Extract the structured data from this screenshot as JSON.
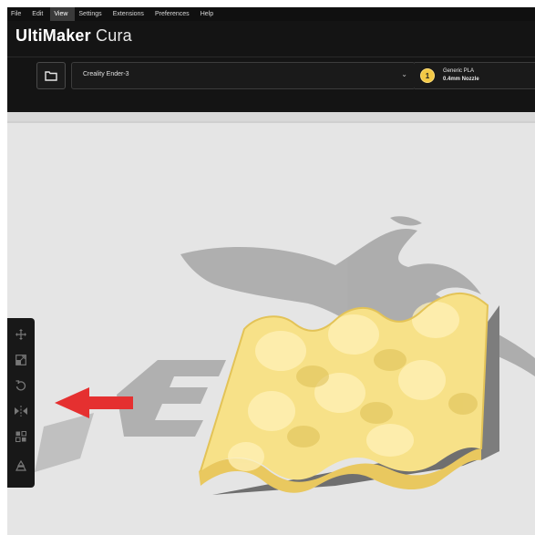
{
  "menubar": {
    "items": [
      {
        "label": "File"
      },
      {
        "label": "Edit"
      },
      {
        "label": "View",
        "active": true
      },
      {
        "label": "Settings"
      },
      {
        "label": "Extensions"
      },
      {
        "label": "Preferences"
      },
      {
        "label": "Help"
      }
    ]
  },
  "header": {
    "logo_brand": "UltiMaker",
    "logo_product": "Cura",
    "printer": "Creality Ender-3",
    "material": "Generic PLA",
    "nozzle": "0.4mm Nozzle",
    "extruder_number": "1"
  },
  "colors": {
    "model_fill": "#f5dd7a",
    "model_edge": "#e8c95a",
    "bed_text": "#a9a9a9",
    "arrow": "#e53030",
    "toolbar_bg": "#181818",
    "header_bg": "#141414"
  },
  "toolbar_icons": [
    "move-icon",
    "scale-icon",
    "rotate-icon",
    "mirror-icon",
    "per-model-settings-icon",
    "support-blocker-icon"
  ]
}
